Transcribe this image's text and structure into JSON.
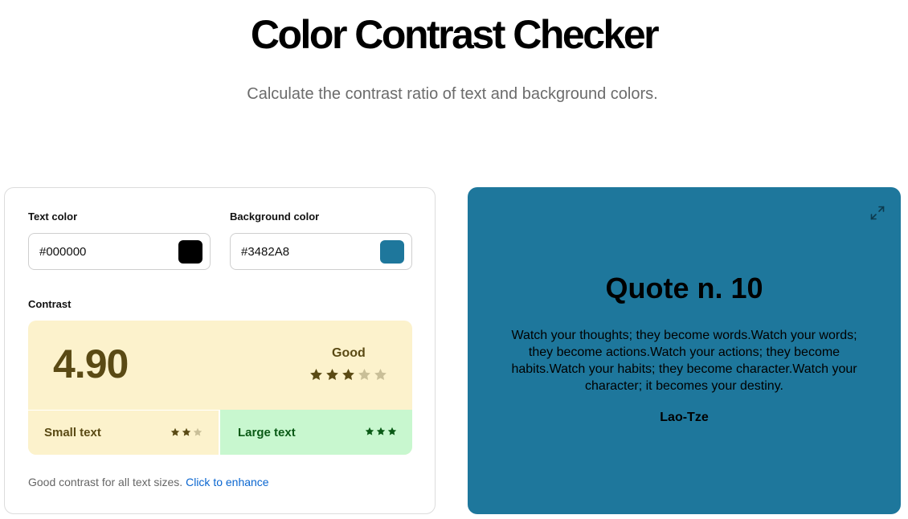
{
  "header": {
    "title": "Color Contrast Checker",
    "subtitle": "Calculate the contrast ratio of text and background colors."
  },
  "inputs": {
    "text_color": {
      "label": "Text color",
      "value": "#000000",
      "swatch": "#000000"
    },
    "background_color": {
      "label": "Background color",
      "value": "#3482A8",
      "swatch": "#1e779c"
    }
  },
  "contrast": {
    "label": "Contrast",
    "ratio": "4.90",
    "rating": "Good",
    "rating_stars": 3,
    "rating_stars_max": 5,
    "small_text": {
      "label": "Small text",
      "stars": 2,
      "max": 3
    },
    "large_text": {
      "label": "Large text",
      "stars": 3,
      "max": 3
    }
  },
  "hint": {
    "text": "Good contrast for all text sizes.",
    "link": "Click to enhance"
  },
  "preview": {
    "title": "Quote n. 10",
    "body": "Watch your thoughts; they become words.Watch your words; they become actions.Watch your actions; they become habits.Watch your habits; they become character.Watch your character; it becomes your destiny.",
    "author": "Lao-Tze",
    "expand_icon": "expand-icon"
  },
  "colors": {
    "rating_fg": "#5a4a14",
    "rating_bg": "#fcf2cc",
    "large_fg": "#0a5a16",
    "large_bg": "#c8f7cf",
    "link": "#0a66d0",
    "preview_bg": "#1e779c"
  }
}
